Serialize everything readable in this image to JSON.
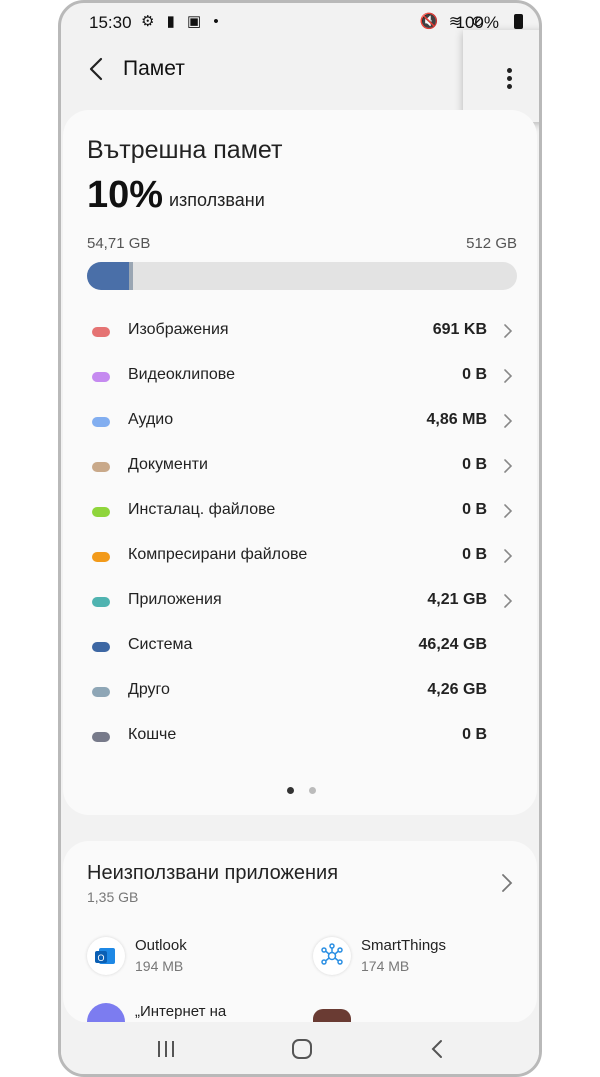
{
  "status": {
    "time": "15:30",
    "left_icons": "⚙ ▮ ▣ •",
    "right_icons": "🔇 ≋ ⊘",
    "battery": "100%"
  },
  "header": {
    "title": "Памет"
  },
  "storage": {
    "title": "Вътрешна памет",
    "percent": "10%",
    "used_label": "използвани",
    "used_amount": "54,71 GB",
    "total_amount": "512 GB",
    "used_fraction": 0.107
  },
  "categories": [
    {
      "name": "Изображения",
      "size": "691 KB",
      "color": "#e57373",
      "chevron": true
    },
    {
      "name": "Видеоклипове",
      "size": "0 B",
      "color": "#c58af0",
      "chevron": true
    },
    {
      "name": "Аудио",
      "size": "4,86 MB",
      "color": "#82aef0",
      "chevron": true
    },
    {
      "name": "Документи",
      "size": "0 B",
      "color": "#c9a98a",
      "chevron": true
    },
    {
      "name": "Инсталац. файлове",
      "size": "0 B",
      "color": "#8fd53b",
      "chevron": true
    },
    {
      "name": "Компресирани файлове",
      "size": "0 B",
      "color": "#f29a1a",
      "chevron": true
    },
    {
      "name": "Приложения",
      "size": "4,21 GB",
      "color": "#4fb3b0",
      "chevron": true
    },
    {
      "name": "Система",
      "size": "46,24 GB",
      "color": "#3d67a3",
      "chevron": false
    },
    {
      "name": "Друго",
      "size": "4,26 GB",
      "color": "#8ea6b6",
      "chevron": false
    },
    {
      "name": "Кошче",
      "size": "0 B",
      "color": "#777a8a",
      "chevron": false
    }
  ],
  "unused_apps": {
    "title": "Неизползвани приложения",
    "size": "1,35 GB",
    "apps": [
      {
        "name": "Outlook",
        "size": "194 MB",
        "icon": "outlook-icon"
      },
      {
        "name": "SmartThings",
        "size": "174 MB",
        "icon": "smartthings-icon"
      },
      {
        "name": "„Интернет на",
        "size": "",
        "icon": "samsung-internet-icon"
      },
      {
        "name": "",
        "size": "",
        "icon": "app-icon"
      }
    ]
  }
}
